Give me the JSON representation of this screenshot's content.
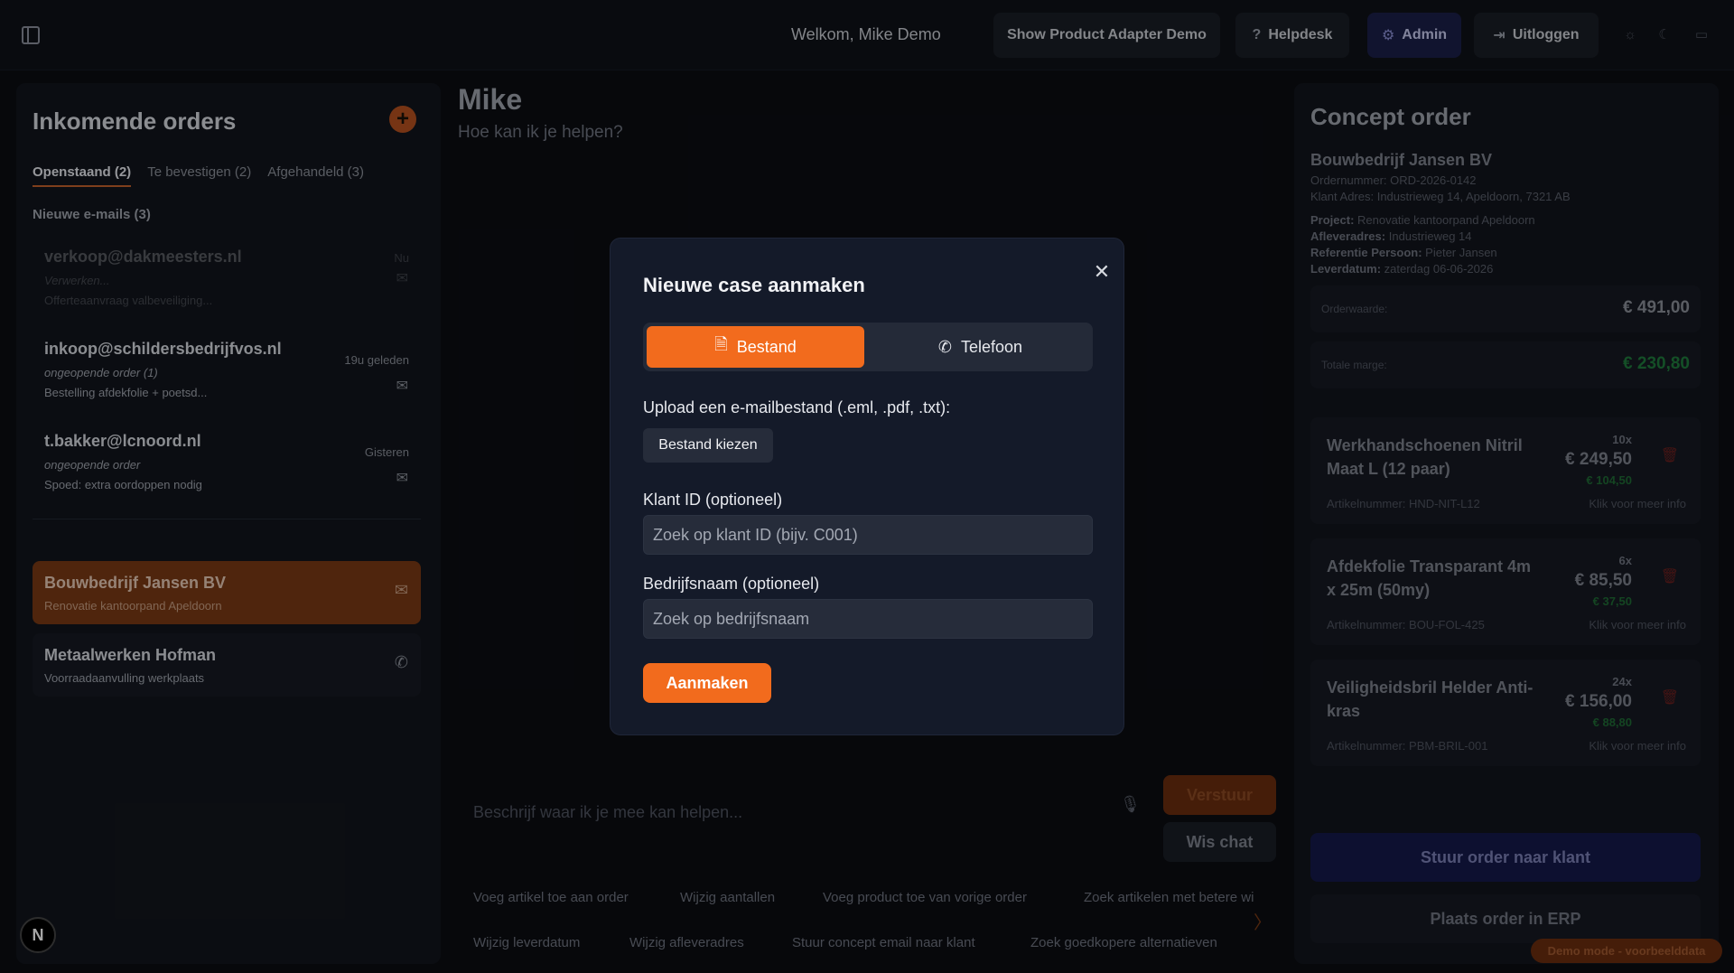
{
  "topbar": {
    "welcome": "Welkom, Mike Demo",
    "buttons": {
      "demo": "Show Product Adapter Demo",
      "helpdesk": "Helpdesk",
      "admin": "Admin",
      "logout": "Uitloggen"
    }
  },
  "left": {
    "title": "Inkomende orders",
    "tabs": {
      "open": "Openstaand (2)",
      "confirm": "Te bevestigen (2)",
      "done": "Afgehandeld (3)"
    },
    "section_label": "Nieuwe e-mails (3)",
    "emails": [
      {
        "from": "verkoop@dakmeesters.nl",
        "status": "Verwerken...",
        "subject": "Offerteaanvraag valbeveiliging...",
        "time": "Nu"
      },
      {
        "from": "inkoop@schildersbedrijfvos.nl",
        "status": "ongeopende order  (1)",
        "subject": "Bestelling afdekfolie + poetsd...",
        "time": "19u geleden"
      },
      {
        "from": "t.bakker@lcnoord.nl",
        "status": "ongeopende order",
        "subject": "Spoed: extra oordoppen nodig",
        "time": "Gisteren"
      }
    ],
    "cases": [
      {
        "name": "Bouwbedrijf Jansen BV",
        "sub": "Renovatie kantoorpand Apeldoorn"
      },
      {
        "name": "Metaalwerken Hofman",
        "sub": "Voorraadaanvulling werkplaats"
      }
    ]
  },
  "center": {
    "title": "Mike",
    "subtitle": "Hoe kan ik je helpen?",
    "input_placeholder": "Beschrijf waar ik je mee kan helpen...",
    "send": "Verstuur",
    "clear": "Wis chat",
    "suggestions_row1": [
      "Voeg artikel toe aan order",
      "Wijzig aantallen",
      "Voeg product toe van vorige order",
      "Zoek artikelen met betere wi"
    ],
    "suggestions_row2": [
      "Wijzig leverdatum",
      "Wijzig afleveradres",
      "Stuur concept email naar klant",
      "Zoek goedkopere alternatieven"
    ]
  },
  "concept": {
    "title": "Concept order",
    "company": "Bouwbedrijf Jansen BV",
    "order_number": "Ordernummer: ORD-2026-0142",
    "address": "Klant Adres: Industrieweg 14, Apeldoorn, 7321 AB",
    "project_label": "Project:",
    "project": "Renovatie kantoorpand Apeldoorn",
    "delivery_label": "Afleveradres:",
    "delivery": "Industrieweg 14",
    "reference_label": "Referentie Persoon:",
    "reference": "Pieter Jansen",
    "date_label": "Leverdatum:",
    "date": "zaterdag 06-06-2026",
    "order_value_label": "Orderwaarde:",
    "order_value": "€ 491,00",
    "margin_label": "Totale marge:",
    "margin": "€ 230,80",
    "items": [
      {
        "name": "Werkhandschoenen Nitril Maat L (12 paar)",
        "qty": "10x",
        "price": "€ 249,50",
        "margin": "€ 104,50",
        "article": "Artikelnummer: HND-NIT-L12",
        "more": "Klik voor meer info"
      },
      {
        "name": "Afdekfolie Transparant 4m x 25m (50my)",
        "qty": "6x",
        "price": "€ 85,50",
        "margin": "€ 37,50",
        "article": "Artikelnummer: BOU-FOL-425",
        "more": "Klik voor meer info"
      },
      {
        "name": "Veiligheidsbril Helder Anti-kras",
        "qty": "24x",
        "price": "€ 156,00",
        "margin": "€ 88,80",
        "article": "Artikelnummer: PBM-BRIL-001",
        "more": "Klik voor meer info"
      }
    ],
    "send_order": "Stuur order naar klant",
    "erp": "Plaats order in ERP"
  },
  "demo_badge": "Demo mode - voorbeelddata",
  "n_badge": "N",
  "modal": {
    "title": "Nieuwe case aanmaken",
    "tab_file": "Bestand",
    "tab_phone": "Telefoon",
    "upload_label": "Upload een e-mailbestand (.eml, .pdf, .txt):",
    "file_button": "Bestand kiezen",
    "client_id_label": "Klant ID (optioneel)",
    "client_id_placeholder": "Zoek op klant ID (bijv. C001)",
    "company_label": "Bedrijfsnaam (optioneel)",
    "company_placeholder": "Zoek op bedrijfsnaam",
    "submit": "Aanmaken"
  },
  "colors": {
    "accent": "#f26b1d",
    "admin": "#1b1f49",
    "margin_green": "#1f7a3c"
  }
}
